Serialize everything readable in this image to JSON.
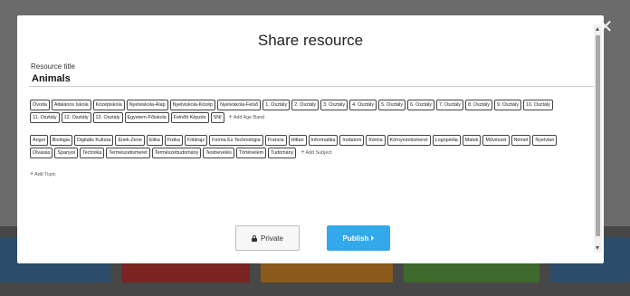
{
  "modal": {
    "title": "Share resource",
    "close_icon": "✕",
    "resource_title_label": "Resource title",
    "resource_title_value": "Animals",
    "age_bands": [
      "Óvoda",
      "Általános Iskola",
      "Középiskola",
      "Nyelviskola-Alap",
      "Nyelviskola-Közép",
      "Nyelviskola-Felső",
      "1. Osztály",
      "2. Osztály",
      "3. Osztály",
      "4. Osztály",
      "5. Osztály",
      "6. Osztály",
      "7. Osztály",
      "8. Osztály",
      "9. Osztály",
      "10. Osztály",
      "11. Osztály",
      "12. Osztály",
      "13. Osztály",
      "Egyetem-Főiskola",
      "Felnőtt Képzés",
      "SNI"
    ],
    "add_age_band": "Add Age Band",
    "subjects": [
      "Angol",
      "Biológia",
      "Digitális Kultúra",
      "Ének-Zene",
      "Etika",
      "Fizika",
      "Földrajz",
      "Forma És Technológia",
      "Francia",
      "Hittan",
      "Informatika",
      "Irodalom",
      "Kémia",
      "Környezetismeret",
      "Logopédia",
      "Matek",
      "Művészet",
      "Német",
      "Nyelvtan",
      "Olvasás",
      "Spanyol",
      "Technika",
      "Természetismeret",
      "Természettudomány",
      "Testnevelés",
      "Történelem",
      "Tudomány"
    ],
    "add_subject": "Add Subject",
    "add_topic": "Add Topic",
    "private_label": "Private",
    "publish_label": "Publish"
  },
  "icons": {
    "private": "lock-icon",
    "publish": "caret-right-icon",
    "add": "plus-icon",
    "close": "close-icon"
  },
  "colors": {
    "publish_button": "#33a8ea",
    "private_button": "#f7f7f7",
    "overlay": "#5a5a5a"
  }
}
